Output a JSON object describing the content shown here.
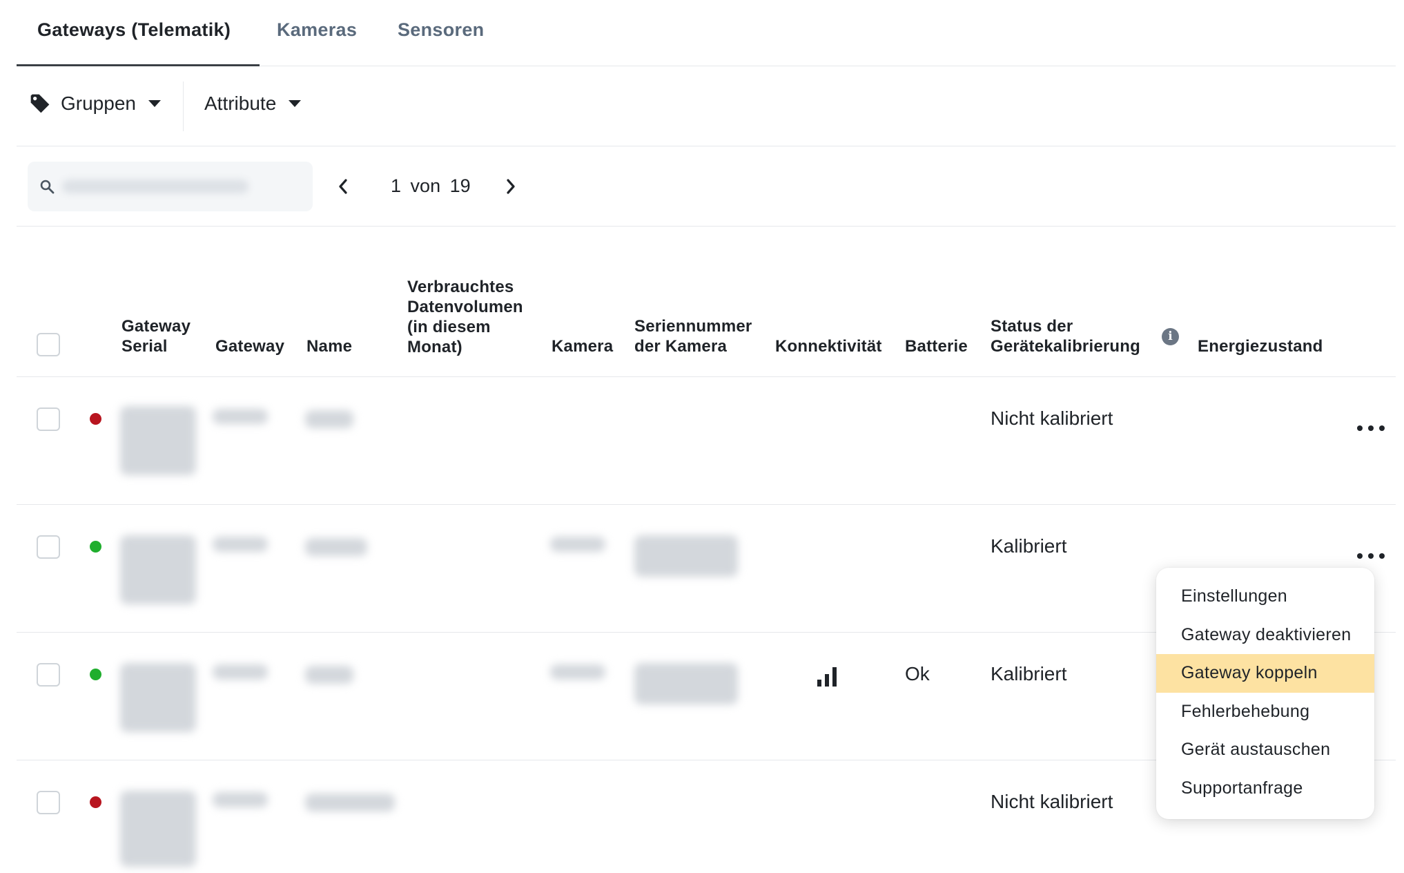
{
  "tabs": [
    {
      "label": "Gateways (Telematik)",
      "active": true
    },
    {
      "label": "Kameras",
      "active": false
    },
    {
      "label": "Sensoren",
      "active": false
    }
  ],
  "filters": {
    "groups_label": "Gruppen",
    "attributes_label": "Attribute",
    "groups_icon": "tag-icon",
    "dropdown_icon": "caret-down-icon"
  },
  "search": {
    "placeholder": "",
    "icon": "search-icon"
  },
  "pager": {
    "current": "1",
    "separator": "von",
    "total": "19",
    "prev_icon": "chevron-left-icon",
    "next_icon": "chevron-right-icon"
  },
  "table": {
    "headers": {
      "gateway_serial": [
        "Gateway",
        "Serial"
      ],
      "gateway": "Gateway",
      "name": "Name",
      "data_volume": [
        "Verbrauchtes",
        "Datenvolumen",
        "(in diesem",
        "Monat)"
      ],
      "camera": "Kamera",
      "camera_serial": [
        "Seriennummer",
        "der Kamera"
      ],
      "connectivity": "Konnektivität",
      "battery": "Batterie",
      "calibration_status": [
        "Status der",
        "Gerätekalibrierung"
      ],
      "energy_state": "Energiezustand"
    },
    "rows": [
      {
        "status_color": "#b8151f",
        "connectivity_icon": "",
        "battery": "",
        "calibration": "Nicht kalibriert"
      },
      {
        "status_color": "#1fae2d",
        "connectivity_icon": "",
        "battery": "",
        "calibration": "Kalibriert"
      },
      {
        "status_color": "#1fae2d",
        "connectivity_icon": "signal-bars-icon",
        "battery": "Ok",
        "calibration": "Kalibriert"
      },
      {
        "status_color": "#b8151f",
        "connectivity_icon": "",
        "battery": "",
        "calibration": "Nicht kalibriert"
      }
    ]
  },
  "row_menu": {
    "items": [
      {
        "label": "Einstellungen",
        "highlighted": false
      },
      {
        "label": "Gateway deaktivieren",
        "highlighted": false
      },
      {
        "label": "Gateway koppeln",
        "highlighted": true
      },
      {
        "label": "Fehlerbehebung",
        "highlighted": false
      },
      {
        "label": "Gerät austauschen",
        "highlighted": false
      },
      {
        "label": "Supportanfrage",
        "highlighted": false
      }
    ],
    "highlight_color": "#fde2a2"
  },
  "colors": {
    "status_offline": "#b8151f",
    "status_online": "#1fae2d",
    "text": "#1f2328",
    "muted_tab": "#5a6a7c"
  }
}
